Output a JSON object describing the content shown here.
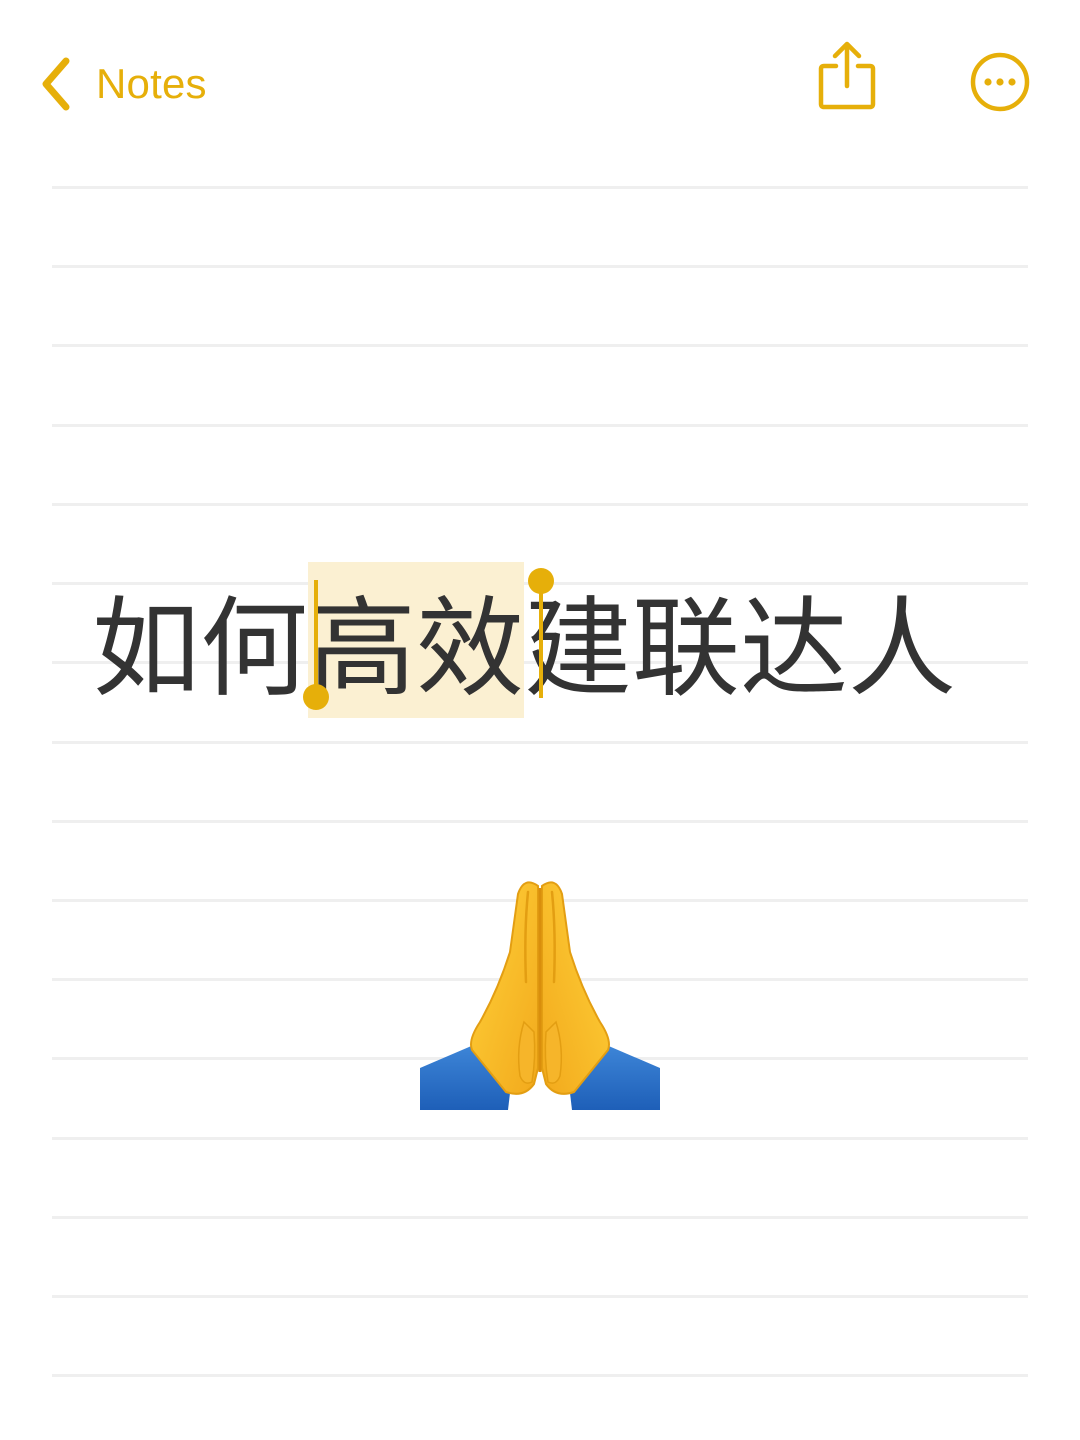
{
  "nav": {
    "back_label": "Notes",
    "back_icon": "chevron-left-icon",
    "share_icon": "share-icon",
    "more_icon": "ellipsis-circle-icon"
  },
  "note": {
    "title_before": "如何",
    "title_selected": "高效",
    "title_after": "建联达人",
    "emoji": "folded-hands-icon"
  },
  "colors": {
    "accent": "#E6AF0A",
    "text": "#333333",
    "selection": "#FBF0D2",
    "rule": "#EFEFEF",
    "background": "#FFFFFF"
  }
}
